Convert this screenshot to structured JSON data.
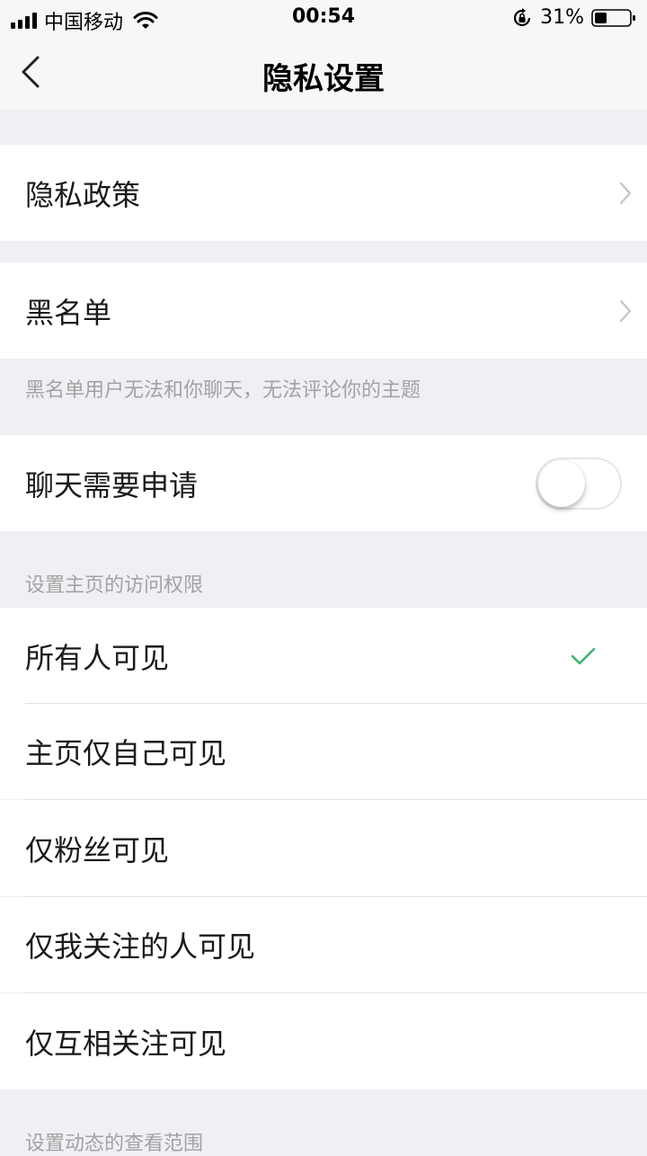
{
  "status_bar": {
    "carrier": "中国移动",
    "time": "00:54",
    "battery": "31%",
    "icons": [
      "signal-icon",
      "wifi-icon",
      "rotation-lock-icon",
      "battery-icon"
    ]
  },
  "nav": {
    "title": "隐私设置",
    "back_icon": "chevron-left-icon"
  },
  "sections": {
    "privacy_policy": {
      "label": "隐私政策"
    },
    "blacklist": {
      "label": "黑名单",
      "hint": "黑名单用户无法和你聊天，无法评论你的主题"
    },
    "chat_request": {
      "label": "聊天需要申请",
      "enabled": false
    },
    "homepage_access": {
      "header": "设置主页的访问权限",
      "options": [
        {
          "label": "所有人可见",
          "selected": true
        },
        {
          "label": "主页仅自己可见",
          "selected": false
        },
        {
          "label": "仅粉丝可见",
          "selected": false
        },
        {
          "label": "仅我关注的人可见",
          "selected": false
        },
        {
          "label": "仅互相关注可见",
          "selected": false
        }
      ]
    },
    "activity_scope": {
      "header": "设置动态的查看范围"
    }
  },
  "colors": {
    "background": "#efeff4",
    "check": "#3cb371",
    "hint_text": "#a3a3a3"
  }
}
